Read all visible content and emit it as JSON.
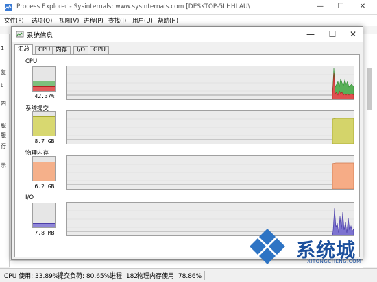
{
  "app": {
    "title": "Process Explorer - Sysinternals: www.sysinternals.com [DESKTOP-5LHHLAU\\",
    "menu": [
      "文件(F)",
      "选项(O)",
      "视图(V)",
      "进程(P)",
      "查找(I)",
      "用户(U)",
      "帮助(H)"
    ],
    "left_fragments": [
      "1",
      "复",
      "t",
      "四",
      "服",
      "服",
      "行",
      "示"
    ]
  },
  "dialog": {
    "title": "系统信息",
    "tabs": [
      "汇总",
      "CPU",
      "内存",
      "I/O",
      "GPU"
    ],
    "active_tab": "汇总"
  },
  "sections": [
    {
      "id": "cpu",
      "label": "CPU",
      "meter_value": "42.37%",
      "fill_level": 0.42,
      "colors": {
        "primary": "#e35b5b",
        "secondary": "#7dc07d"
      }
    },
    {
      "id": "commit",
      "label": "系统提交",
      "meter_value": "8.7 GB",
      "fill_level": 0.81,
      "colors": {
        "primary": "#d8d870",
        "outline": "#a8a830"
      }
    },
    {
      "id": "memory",
      "label": "物理内存",
      "meter_value": "6.2 GB",
      "fill_level": 0.79,
      "colors": {
        "primary": "#f5b08a",
        "outline": "#d07a50"
      }
    },
    {
      "id": "io",
      "label": "I/O",
      "meter_value": "7.8  MB",
      "fill_level": 0.18,
      "colors": {
        "primary": "#8f86d8",
        "outline": "#4d3fa8"
      }
    }
  ],
  "status_bar": {
    "cpu": "CPU 使用: 33.89%",
    "commit": "提交负荷: 80.65%",
    "processes": "进程: 182",
    "physical_memory": "物理内存使用: 78.86%"
  },
  "watermark": {
    "text": "系统城",
    "url": "XITONGCHENG.COM"
  },
  "icons": [
    "process-explorer-icon",
    "minimize-icon",
    "maximize-icon",
    "close-icon"
  ]
}
